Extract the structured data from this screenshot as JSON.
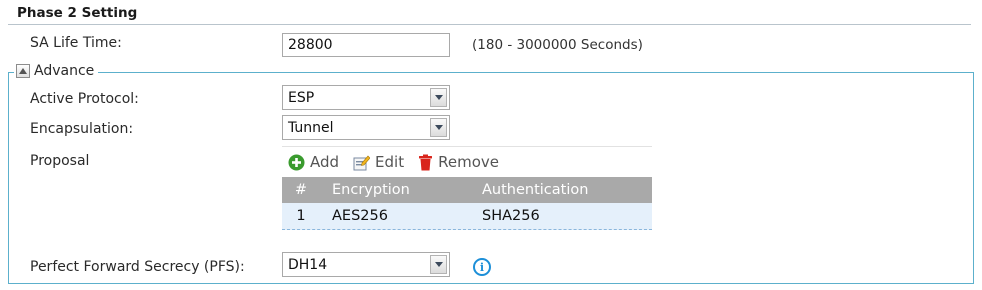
{
  "section": {
    "title": "Phase 2 Setting"
  },
  "sa_life_time": {
    "label": "SA Life Time:",
    "value": "28800",
    "hint": "(180 - 3000000 Seconds)"
  },
  "advance": {
    "legend": "Advance",
    "active_protocol": {
      "label": "Active Protocol:",
      "selected": "ESP"
    },
    "encapsulation": {
      "label": "Encapsulation:",
      "selected": "Tunnel"
    },
    "proposal": {
      "label": "Proposal",
      "toolbar": {
        "add": "Add",
        "edit": "Edit",
        "remove": "Remove"
      },
      "columns": [
        "#",
        "Encryption",
        "Authentication"
      ],
      "rows": [
        {
          "num": "1",
          "encryption": "AES256",
          "authentication": "SHA256"
        }
      ]
    },
    "pfs": {
      "label": "Perfect Forward Secrecy (PFS):",
      "selected": "DH14"
    }
  },
  "colors": {
    "fieldset_border": "#5cb0cc",
    "grid_header": "#a9a9a9",
    "row_selected": "#e5f0fb",
    "add_green": "#3a9b2e",
    "remove_red": "#d9251c",
    "info_blue": "#1d8fd8"
  },
  "icons": {
    "add": "plus-circle-icon",
    "edit": "edit-pencil-icon",
    "remove": "trash-icon",
    "info": "info-icon",
    "collapse": "collapse-up-icon",
    "dropdown": "chevron-down-icon"
  }
}
